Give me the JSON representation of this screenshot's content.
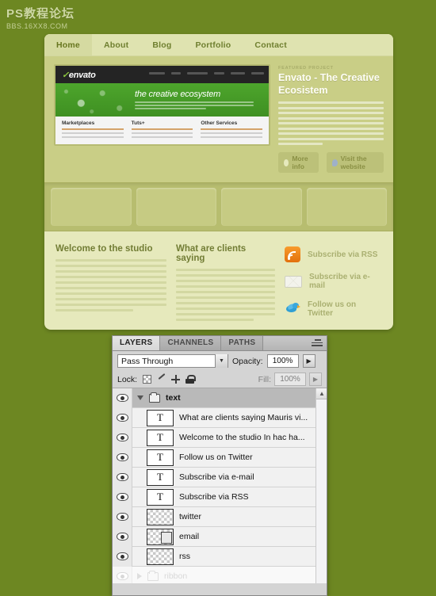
{
  "watermark": {
    "main": "PS教程论坛",
    "sub": "BBS.16XX8.COM"
  },
  "site": {
    "nav": [
      {
        "label": "Home",
        "active": true
      },
      {
        "label": "About",
        "active": false
      },
      {
        "label": "Blog",
        "active": false
      },
      {
        "label": "Portfolio",
        "active": false
      },
      {
        "label": "Contact",
        "active": false
      }
    ],
    "screenshot": {
      "logo_mark": "✓",
      "logo": "envato",
      "tagline": "the creative ecosystem",
      "columns": [
        {
          "title": "Marketplaces"
        },
        {
          "title": "Tuts+"
        },
        {
          "title": "Other Services"
        }
      ]
    },
    "feature": {
      "kicker": "FEATURED PROJECT",
      "title": "Envato - The Creative Ecosistem",
      "buttons": [
        {
          "label": "More info",
          "icon": "bulb-icon"
        },
        {
          "label": "Visit the website",
          "icon": "magnifier-icon"
        }
      ]
    },
    "columns": [
      {
        "title": "Welcome to the studio"
      },
      {
        "title": "What are clients saying"
      }
    ],
    "subscribe": [
      {
        "label": "Subscribe via RSS",
        "icon": "rss-icon",
        "color": "#e2700d"
      },
      {
        "label": "Subscribe via e-mail",
        "icon": "envelope-icon",
        "color": "#f3f3ec"
      },
      {
        "label": "Follow us on Twitter",
        "icon": "twitter-bird-icon",
        "color": "#2f9fd4"
      }
    ]
  },
  "photoshop": {
    "tabs": [
      {
        "label": "LAYERS",
        "active": true
      },
      {
        "label": "CHANNELS",
        "active": false
      },
      {
        "label": "PATHS",
        "active": false
      }
    ],
    "blend_mode": "Pass Through",
    "opacity_label": "Opacity:",
    "opacity_value": "100%",
    "lock_label": "Lock:",
    "fill_label": "Fill:",
    "fill_value": "100%",
    "lock_icons": [
      "lock-transparency-icon",
      "lock-image-icon",
      "lock-position-icon",
      "lock-all-icon"
    ],
    "layers": [
      {
        "name": "text",
        "type": "group",
        "expanded": true,
        "visible": true,
        "faded": false,
        "selected": true
      },
      {
        "name": "What are clients saying  Mauris vi...",
        "type": "text",
        "visible": true,
        "faded": false
      },
      {
        "name": "Welcome to the studio  In hac ha...",
        "type": "text",
        "visible": true,
        "faded": false
      },
      {
        "name": "Follow us on Twitter",
        "type": "text",
        "visible": true,
        "faded": false
      },
      {
        "name": "Subscribe via e-mail",
        "type": "text",
        "visible": true,
        "faded": false
      },
      {
        "name": "Subscribe via RSS",
        "type": "text",
        "visible": true,
        "faded": false
      },
      {
        "name": "twitter",
        "type": "pixel",
        "visible": true,
        "faded": false
      },
      {
        "name": "email",
        "type": "pixel-linked",
        "visible": true,
        "faded": false
      },
      {
        "name": "rss",
        "type": "pixel",
        "visible": true,
        "faded": false
      },
      {
        "name": "ribbon",
        "type": "group",
        "expanded": false,
        "visible": true,
        "faded": true
      }
    ]
  }
}
